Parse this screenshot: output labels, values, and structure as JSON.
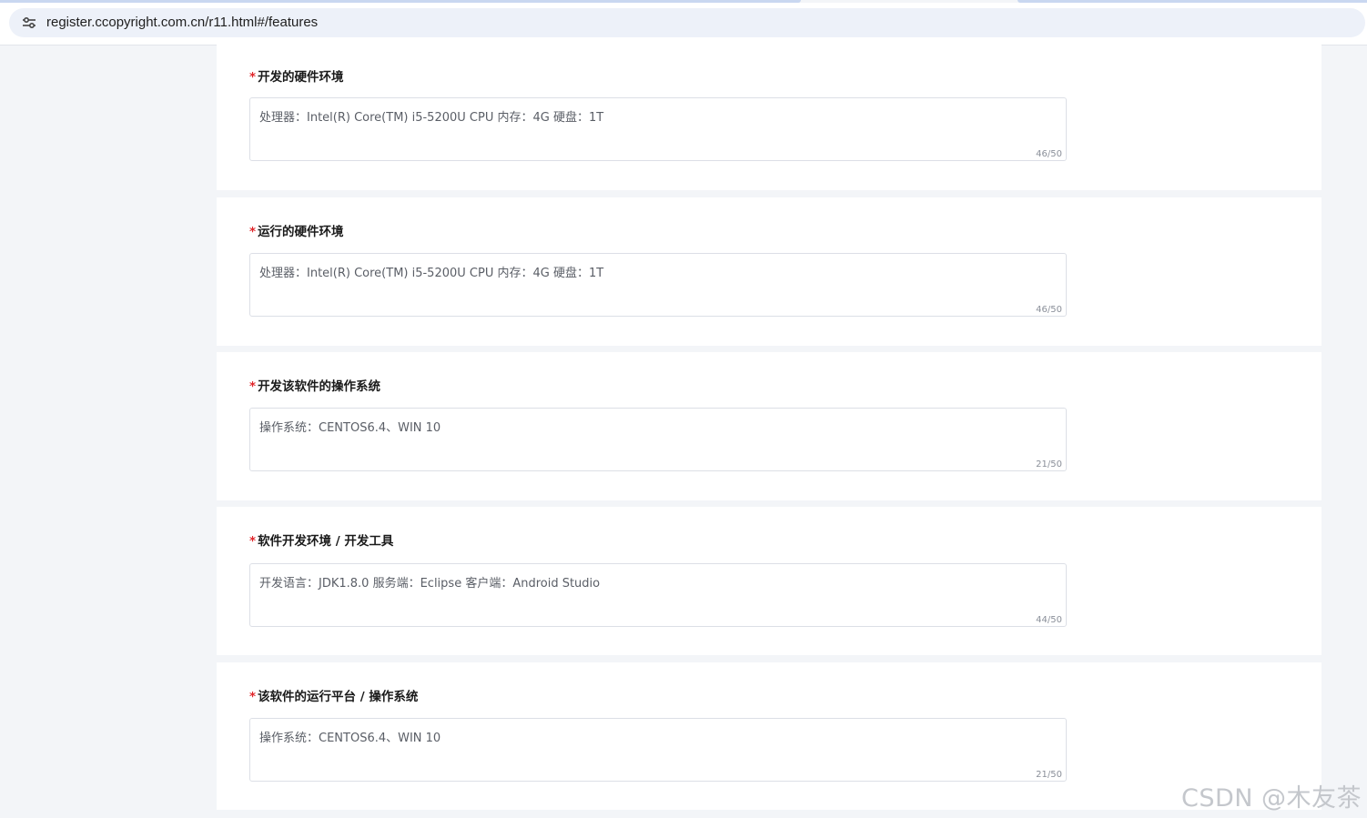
{
  "browser": {
    "url": "register.ccopyright.com.cn/r11.html#/features"
  },
  "fields": [
    {
      "label": "开发的硬件环境",
      "value": "处理器：Intel(R) Core(TM) i5-5200U CPU 内存：4G 硬盘：1T",
      "count": "46/50"
    },
    {
      "label": "运行的硬件环境",
      "value": "处理器：Intel(R) Core(TM) i5-5200U CPU 内存：4G 硬盘：1T",
      "count": "46/50"
    },
    {
      "label": "开发该软件的操作系统",
      "value": "操作系统：CENTOS6.4、WIN 10",
      "count": "21/50"
    },
    {
      "label": "软件开发环境 / 开发工具",
      "value": "开发语言：JDK1.8.0 服务端：Eclipse 客户端：Android Studio",
      "count": "44/50"
    },
    {
      "label": "该软件的运行平台 / 操作系统",
      "value": "操作系统：CENTOS6.4、WIN 10",
      "count": "21/50"
    }
  ],
  "required_marker": "*",
  "watermark": "CSDN @木友茶",
  "colors": {
    "required": "#e0262b",
    "page_background": "#f3f5f8",
    "card_background": "#ffffff",
    "border": "#dcdfe6"
  }
}
